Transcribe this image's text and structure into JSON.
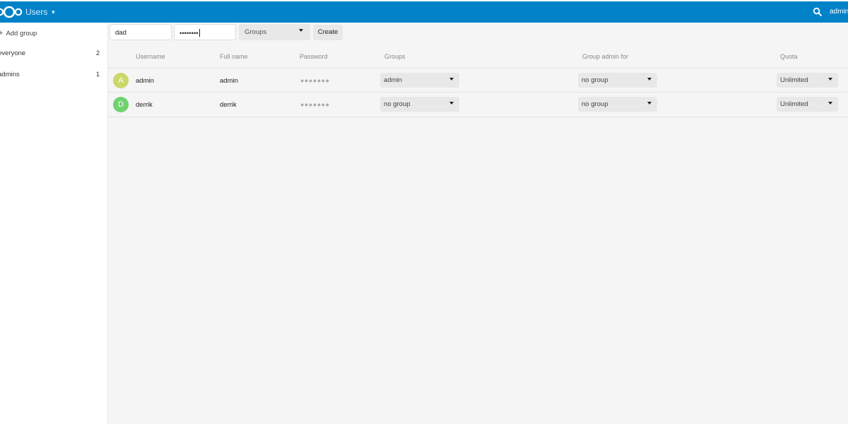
{
  "header": {
    "app_name": "Users",
    "user_name": "admin",
    "bg_color": "#0082c9"
  },
  "sidebar": {
    "add_group_label": "Add group",
    "groups": [
      {
        "label": "everyone",
        "count": "2"
      },
      {
        "label": "admins",
        "count": "1"
      }
    ]
  },
  "new_user": {
    "username_value": "dad",
    "password_value": "••••••••",
    "groups_placeholder": "Groups",
    "create_label": "Create"
  },
  "table": {
    "headers": {
      "username": "Username",
      "fullname": "Full name",
      "password": "Password",
      "groups": "Groups",
      "subadmin": "Group admin for",
      "quota": "Quota"
    },
    "rows": [
      {
        "avatar_letter": "A",
        "avatar_color": "#c9d86a",
        "username": "admin",
        "fullname": "admin",
        "password": "●●●●●●●",
        "groups": "admin",
        "subadmin": "no group",
        "quota": "Unlimited"
      },
      {
        "avatar_letter": "D",
        "avatar_color": "#6ed36e",
        "username": "derrik",
        "fullname": "derrik",
        "password": "●●●●●●●",
        "groups": "no group",
        "subadmin": "no group",
        "quota": "Unlimited"
      }
    ]
  }
}
